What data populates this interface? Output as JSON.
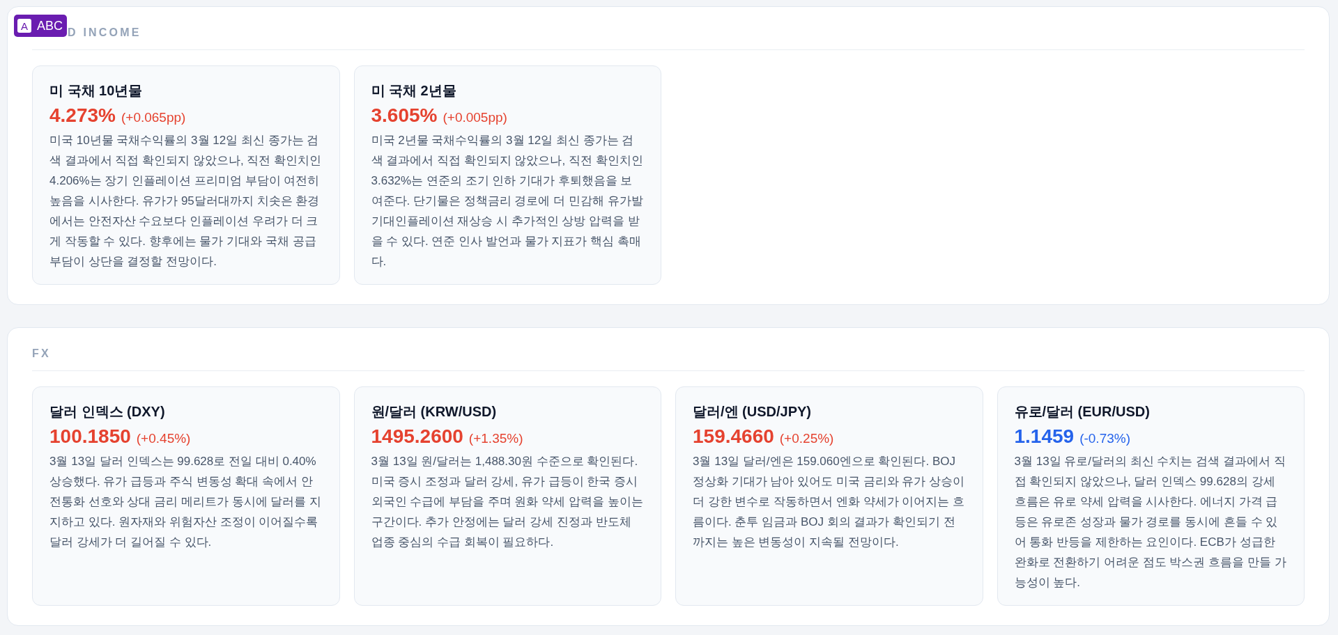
{
  "overlay_badge": {
    "letter": "A",
    "label": "ABC"
  },
  "sections": [
    {
      "heading": "D INCOME",
      "cards": [
        {
          "title": "미 국채 10년물",
          "value": "4.273%",
          "change": "(+0.065pp)",
          "color": "#e5422f",
          "description": "미국 10년물 국채수익률의 3월 12일 최신 종가는 검색 결과에서 직접 확인되지 않았으나, 직전 확인치인 4.206%는 장기 인플레이션 프리미엄 부담이 여전히 높음을 시사한다. 유가가 95달러대까지 치솟은 환경에서는 안전자산 수요보다 인플레이션 우려가 더 크게 작동할 수 있다. 향후에는 물가 기대와 국채 공급 부담이 상단을 결정할 전망이다."
        },
        {
          "title": "미 국채 2년물",
          "value": "3.605%",
          "change": "(+0.005pp)",
          "color": "#e5422f",
          "description": "미국 2년물 국채수익률의 3월 12일 최신 종가는 검색 결과에서 직접 확인되지 않았으나, 직전 확인치인 3.632%는 연준의 조기 인하 기대가 후퇴했음을 보여준다. 단기물은 정책금리 경로에 더 민감해 유가발 기대인플레이션 재상승 시 추가적인 상방 압력을 받을 수 있다. 연준 인사 발언과 물가 지표가 핵심 촉매다."
        }
      ]
    },
    {
      "heading": "FX",
      "cards": [
        {
          "title": "달러 인덱스 (DXY)",
          "value": "100.1850",
          "change": "(+0.45%)",
          "color": "#e5422f",
          "description": "3월 13일 달러 인덱스는 99.628로 전일 대비 0.40% 상승했다. 유가 급등과 주식 변동성 확대 속에서 안전통화 선호와 상대 금리 메리트가 동시에 달러를 지지하고 있다. 원자재와 위험자산 조정이 이어질수록 달러 강세가 더 길어질 수 있다."
        },
        {
          "title": "원/달러 (KRW/USD)",
          "value": "1495.2600",
          "change": "(+1.35%)",
          "color": "#e5422f",
          "description": "3월 13일 원/달러는 1,488.30원 수준으로 확인된다. 미국 증시 조정과 달러 강세, 유가 급등이 한국 증시 외국인 수급에 부담을 주며 원화 약세 압력을 높이는 구간이다. 추가 안정에는 달러 강세 진정과 반도체 업종 중심의 수급 회복이 필요하다."
        },
        {
          "title": "달러/엔 (USD/JPY)",
          "value": "159.4660",
          "change": "(+0.25%)",
          "color": "#e5422f",
          "description": "3월 13일 달러/엔은 159.060엔으로 확인된다. BOJ 정상화 기대가 남아 있어도 미국 금리와 유가 상승이 더 강한 변수로 작동하면서 엔화 약세가 이어지는 흐름이다. 춘투 임금과 BOJ 회의 결과가 확인되기 전까지는 높은 변동성이 지속될 전망이다."
        },
        {
          "title": "유로/달러 (EUR/USD)",
          "value": "1.1459",
          "change": "(-0.73%)",
          "color": "#2563eb",
          "description": "3월 13일 유로/달러의 최신 수치는 검색 결과에서 직접 확인되지 않았으나, 달러 인덱스 99.628의 강세 흐름은 유로 약세 압력을 시사한다. 에너지 가격 급등은 유로존 성장과 물가 경로를 동시에 흔들 수 있어 통화 반등을 제한하는 요인이다. ECB가 성급한 완화로 전환하기 어려운 점도 박스권 흐름을 만들 가능성이 높다."
        }
      ]
    }
  ]
}
